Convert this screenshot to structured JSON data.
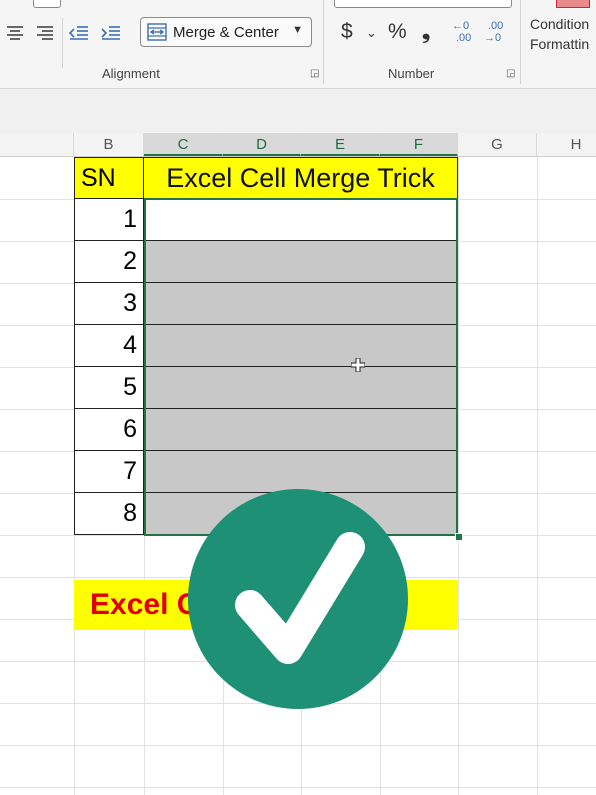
{
  "ribbon": {
    "alignment_group_label": "Alignment",
    "number_group_label": "Number",
    "merge_button_label": "Merge & Center",
    "currency_symbol": "$",
    "percent_symbol": "%",
    "comma_symbol": "❟",
    "increase_decimal_top": "←0",
    "increase_decimal_bottom": ".00",
    "decrease_decimal_top": ".00",
    "decrease_decimal_bottom": "→0",
    "conditional_formatting_line1": "Condition",
    "conditional_formatting_line2": "Formattin"
  },
  "columns": [
    "B",
    "C",
    "D",
    "E",
    "F",
    "G",
    "H"
  ],
  "table": {
    "sn_header": "SN",
    "title_header": "Excel Cell Merge Trick",
    "rows": [
      "1",
      "2",
      "3",
      "4",
      "5",
      "6",
      "7",
      "8"
    ]
  },
  "banner": {
    "text": "Excel Cell Merge Trick"
  },
  "colors": {
    "highlight_yellow": "#ffff00",
    "banner_text_red": "#e00000",
    "selection_green": "#217346",
    "badge_teal": "#1e9075",
    "merge_gray": "#c8c8c8"
  }
}
